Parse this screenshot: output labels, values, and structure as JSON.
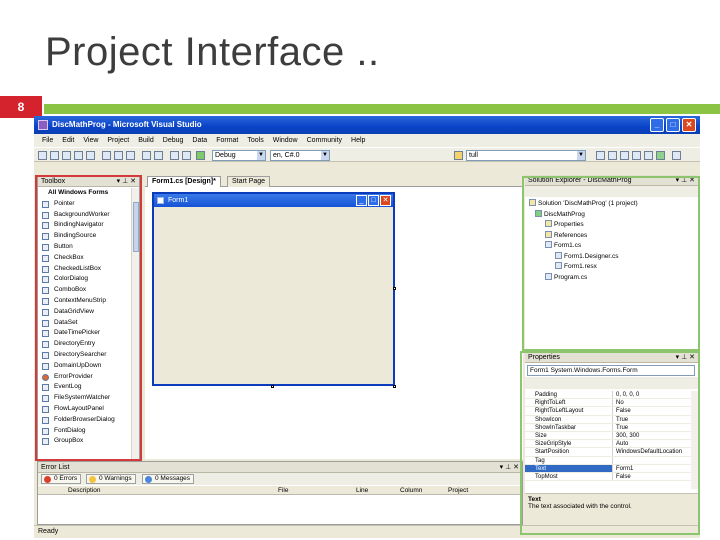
{
  "slide": {
    "title": "Project Interface ..",
    "page_number": "8",
    "accent_color": "#8bc344",
    "page_number_color": "#d5232e"
  },
  "ide": {
    "title": "DiscMathProg - Microsoft Visual Studio",
    "window_buttons": [
      "_",
      "□",
      "✕"
    ],
    "menu": [
      "File",
      "Edit",
      "View",
      "Project",
      "Build",
      "Debug",
      "Data",
      "Format",
      "Tools",
      "Window",
      "Community",
      "Help"
    ],
    "toolbar": {
      "config_combo": "Debug",
      "platform_combo": "en, C#.0",
      "find_combo": "tull"
    },
    "toolbox": {
      "header": "Toolbox",
      "group": "All Windows Forms",
      "items": [
        "Pointer",
        "BackgroundWorker",
        "BindingNavigator",
        "BindingSource",
        "Button",
        "CheckBox",
        "CheckedListBox",
        "ColorDialog",
        "ComboBox",
        "ContextMenuStrip",
        "DataGridView",
        "DataSet",
        "DateTimePicker",
        "DirectoryEntry",
        "DirectorySearcher",
        "DomainUpDown",
        "ErrorProvider",
        "EventLog",
        "FileSystemWatcher",
        "FlowLayoutPanel",
        "FolderBrowserDialog",
        "FontDialog",
        "GroupBox"
      ]
    },
    "designer": {
      "tabs": [
        "Form1.cs [Design]*",
        "Start Page"
      ],
      "form_title": "Form1"
    },
    "solution_explorer": {
      "header": "Solution Explorer - DiscMathProg",
      "nodes": [
        "Solution 'DiscMathProg' (1 project)",
        "DiscMathProg",
        "Properties",
        "References",
        "Form1.cs",
        "Form1.Designer.cs",
        "Form1.resx",
        "Program.cs"
      ]
    },
    "properties": {
      "header": "Properties",
      "object_combo": "Form1 System.Windows.Forms.Form",
      "rows": [
        {
          "k": "Padding",
          "v": "0, 0, 0, 0"
        },
        {
          "k": "RightToLeft",
          "v": "No"
        },
        {
          "k": "RightToLeftLayout",
          "v": "False"
        },
        {
          "k": "ShowIcon",
          "v": "True"
        },
        {
          "k": "ShowInTaskbar",
          "v": "True"
        },
        {
          "k": "Size",
          "v": "300, 300"
        },
        {
          "k": "SizeGripStyle",
          "v": "Auto"
        },
        {
          "k": "StartPosition",
          "v": "WindowsDefaultLocation"
        },
        {
          "k": "Tag",
          "v": ""
        },
        {
          "k": "Text",
          "v": "Form1"
        },
        {
          "k": "TopMost",
          "v": "False"
        }
      ],
      "desc_title": "Text",
      "desc_text": "The text associated with the control."
    },
    "error_list": {
      "header": "Error List",
      "tabs": [
        "0 Errors",
        "0 Warnings",
        "0 Messages"
      ],
      "columns": [
        "Description",
        "File",
        "Line",
        "Column",
        "Project"
      ]
    },
    "status": "Ready"
  }
}
